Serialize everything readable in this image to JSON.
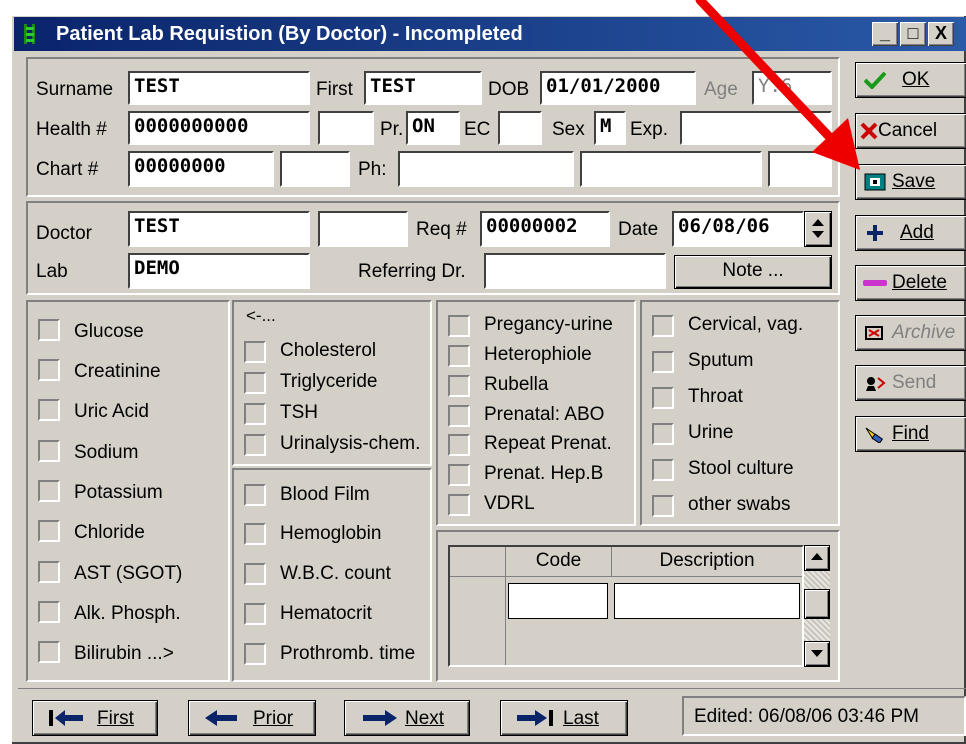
{
  "window": {
    "title": "Patient Lab Requistion (By Doctor) - Incompleted",
    "minimize": "_",
    "maximize": "□",
    "close": "X"
  },
  "patient": {
    "surname_label": "Surname",
    "surname": "TEST",
    "first_label": "First",
    "first": "TEST",
    "dob_label": "DOB",
    "dob": "01/01/2000",
    "age_label": "Age",
    "age": "Y:6",
    "health_label": "Health #",
    "health": "0000000000",
    "health_extra": "",
    "pr_label": "Pr.",
    "pr": "ON",
    "ec_label": "EC",
    "ec": "",
    "sex_label": "Sex",
    "sex": "M",
    "exp_label": "Exp.",
    "exp": "",
    "chart_label": "Chart #",
    "chart": "00000000",
    "chart_extra": "",
    "ph_label": "Ph:",
    "ph1": "",
    "ph2": "",
    "ph3": ""
  },
  "request": {
    "doctor_label": "Doctor",
    "doctor": "TEST",
    "doctor_extra": "",
    "req_label": "Req #",
    "req": "00000002",
    "date_label": "Date",
    "date": "06/08/06",
    "lab_label": "Lab",
    "lab": "DEMO",
    "referring_label": "Referring Dr.",
    "referring": "",
    "note_button": "Note ..."
  },
  "tests": {
    "col1": [
      "Glucose",
      "Creatinine",
      "Uric Acid",
      "Sodium",
      "Potassium",
      "Chloride",
      "AST (SGOT)",
      "Alk. Phosph.",
      "Bilirubin ...>"
    ],
    "col2_header": "<-...",
    "col2a": [
      "Cholesterol",
      "Triglyceride",
      "TSH",
      "Urinalysis-chem."
    ],
    "col2b": [
      "Blood Film",
      "Hemoglobin",
      "W.B.C. count",
      "Hematocrit",
      "Prothromb. time"
    ],
    "col3": [
      "Pregancy-urine",
      "Heterophiole",
      "Rubella",
      "Prenatal: ABO",
      "Repeat Prenat.",
      "Prenat. Hep.B",
      "VDRL"
    ],
    "col4": [
      "Cervical, vag.",
      "Sputum",
      "Throat",
      "Urine",
      "Stool culture",
      "other swabs"
    ]
  },
  "grid": {
    "headers": [
      "Code",
      "Description"
    ],
    "rows": [
      [
        "",
        ""
      ]
    ]
  },
  "side_buttons": {
    "ok": "OK",
    "cancel": "Cancel",
    "save": "Save",
    "add": "Add",
    "delete": "Delete",
    "archive": "Archive",
    "send": "Send",
    "find": "Find"
  },
  "nav": {
    "first": "First",
    "prior": "Prior",
    "next": "Next",
    "last": "Last",
    "status": "Edited: 06/08/06 03:46 PM"
  },
  "colors": {
    "titlebar": "#0a246a",
    "face": "#d4d0c8",
    "annotation_arrow": "#ee0000"
  }
}
